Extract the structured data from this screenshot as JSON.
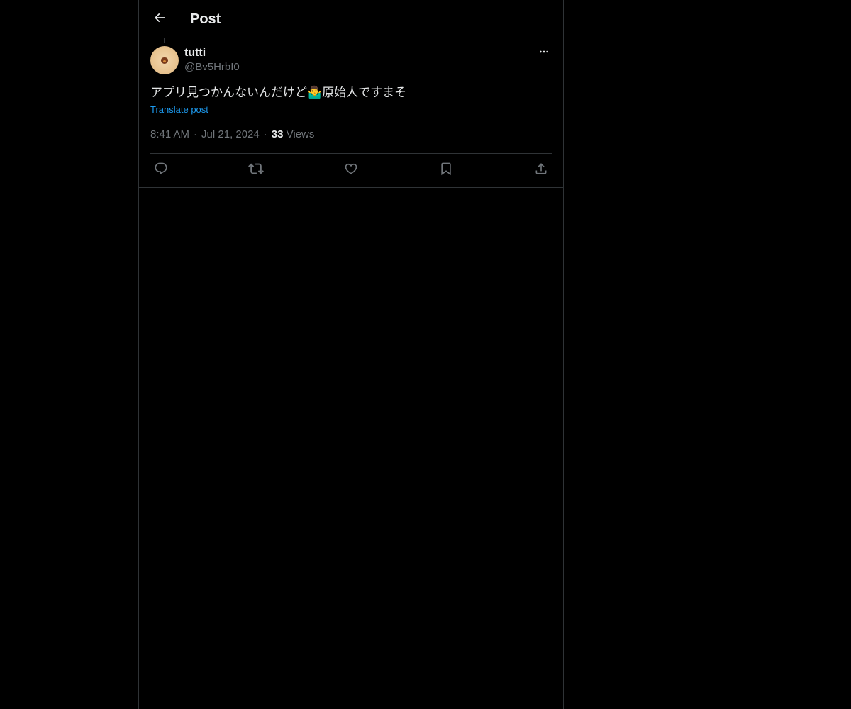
{
  "header": {
    "back_icon": "arrow-left-icon",
    "title": "Post"
  },
  "post": {
    "author": {
      "display_name": "tutti",
      "handle": "@Bv5HrbI0",
      "avatar_icon": "avatar-image"
    },
    "text_before_emoji": "アプリ見つかんないんだけど",
    "emoji": "🤷‍♂️",
    "text_after_emoji": "原始人ですまそ",
    "translate_label": "Translate post",
    "time": "8:41 AM",
    "date": "Jul 21, 2024",
    "views_count": "33",
    "views_label": "Views",
    "more_icon": "more-horizontal-icon"
  },
  "actions": [
    {
      "name": "reply",
      "icon": "reply-icon"
    },
    {
      "name": "repost",
      "icon": "repost-icon"
    },
    {
      "name": "like",
      "icon": "heart-icon"
    },
    {
      "name": "bookmark",
      "icon": "bookmark-icon"
    },
    {
      "name": "share",
      "icon": "share-icon"
    }
  ],
  "colors": {
    "background": "#000000",
    "text": "#e7e9ea",
    "secondary_text": "#71767b",
    "link": "#1d9bf0",
    "border": "#2f3336"
  }
}
